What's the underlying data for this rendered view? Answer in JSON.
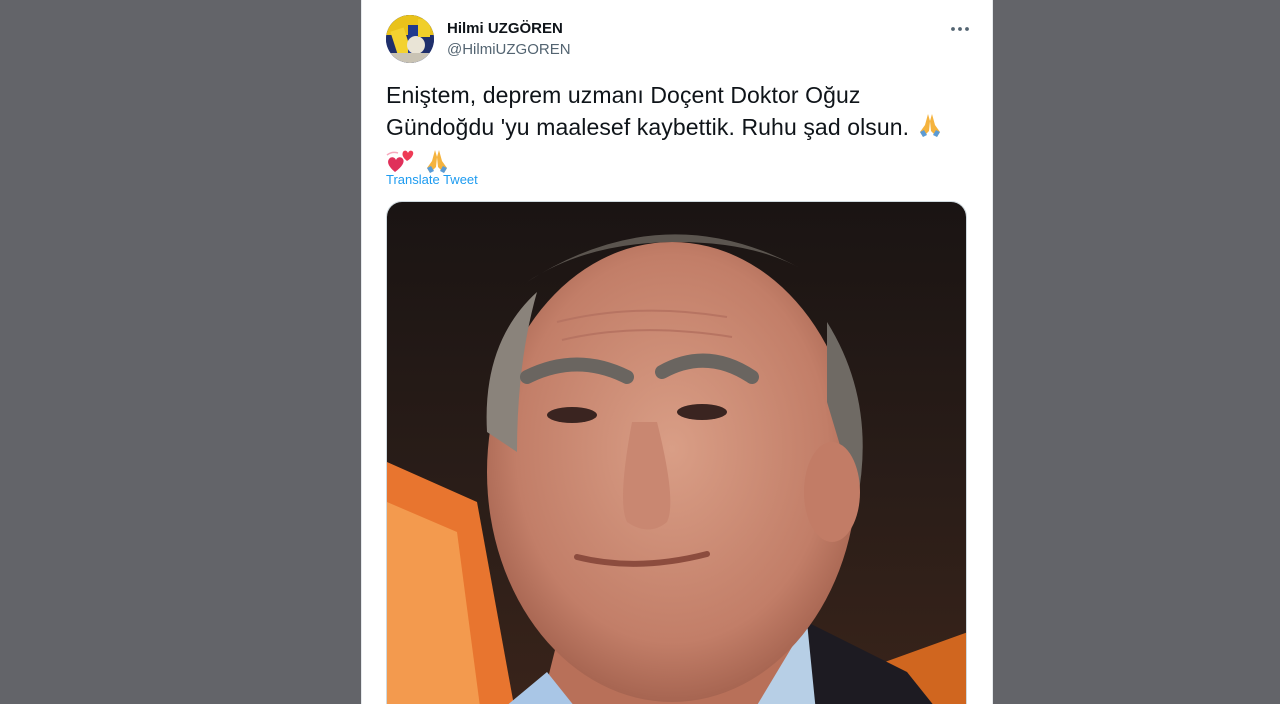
{
  "tweet": {
    "display_name": "Hilmi UZGÖREN",
    "handle": "@HilmiUZGOREN",
    "text_line1": "Enişte‌m, deprem uzmanı Doçent Doktor Oğuz",
    "text_line2": "Gündoğdu 'yu maalesef kaybettik. Ruhu şad olsun.",
    "translate_label": "Translate Tweet",
    "more_icon": "more-horizontal-icon",
    "emoji_1": "folded-hands-emoji",
    "emoji_2": "two-hearts-emoji",
    "emoji_3": "folded-hands-emoji"
  },
  "colors": {
    "background": "#636469",
    "link": "#1d9bf0",
    "text": "#0f1419",
    "muted": "#536471"
  }
}
